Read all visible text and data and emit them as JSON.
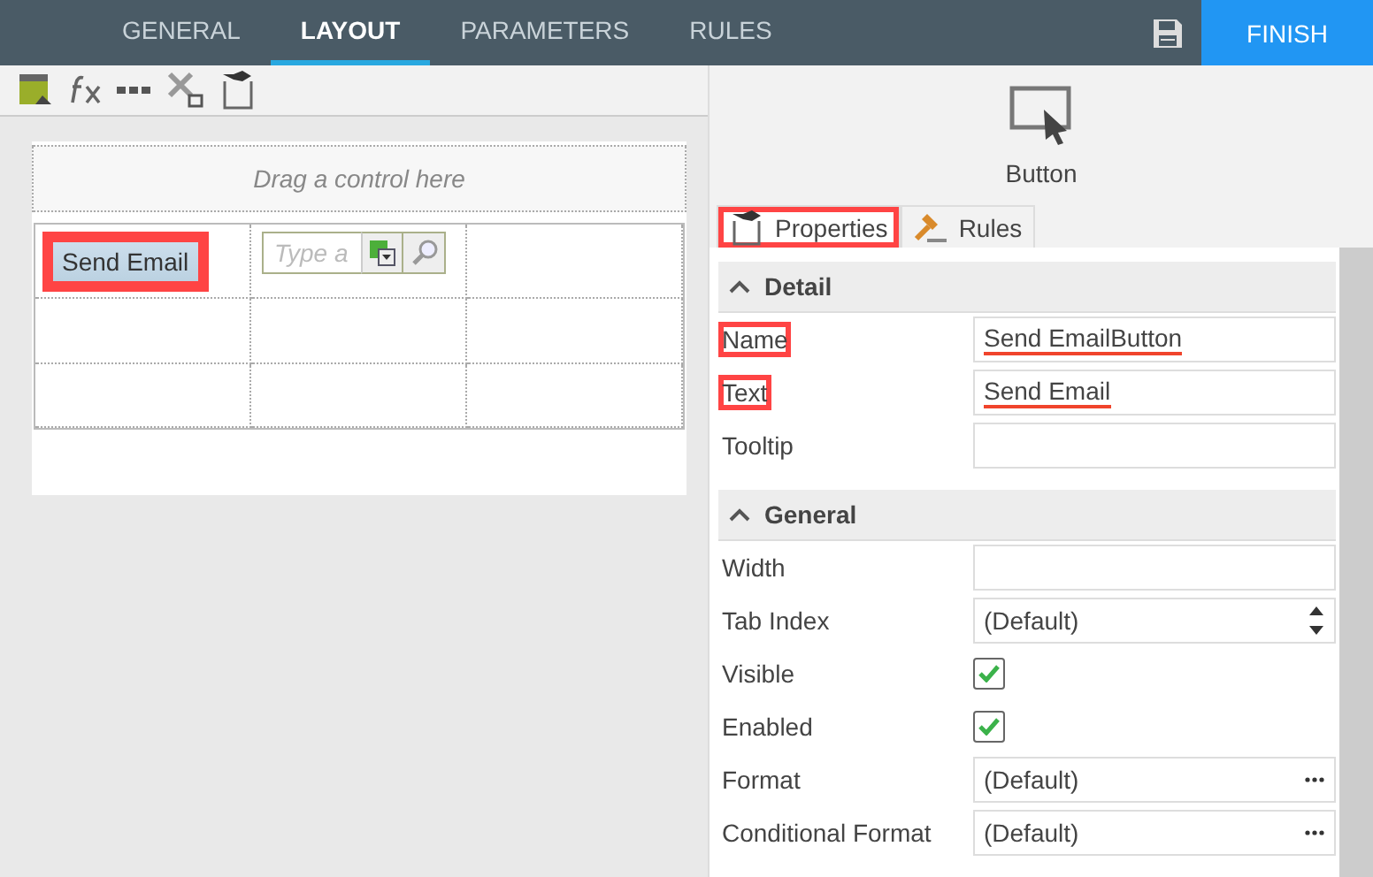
{
  "tabs": [
    {
      "label": "GENERAL",
      "selected": false
    },
    {
      "label": "LAYOUT",
      "selected": true
    },
    {
      "label": "PARAMETERS",
      "selected": false
    },
    {
      "label": "RULES",
      "selected": false
    }
  ],
  "finish_button": "FINISH",
  "canvas": {
    "drop_zone": "Drag a control here",
    "button": {
      "label": "Send Email",
      "highlighted": true
    },
    "picker": {
      "placeholder": "Type a"
    }
  },
  "control": {
    "type_label": "Button"
  },
  "panel_tabs": [
    {
      "label": "Properties",
      "selected": true,
      "highlighted": true
    },
    {
      "label": "Rules",
      "selected": false,
      "highlighted": false
    }
  ],
  "sections": [
    {
      "title": "Detail",
      "expanded": true,
      "rows": [
        {
          "label": "Name",
          "kind": "text",
          "value": "Send EmailButton",
          "highlighted": true,
          "underlined": true
        },
        {
          "label": "Text",
          "kind": "text",
          "value": "Send Email",
          "highlighted": true,
          "underlined": true
        },
        {
          "label": "Tooltip",
          "kind": "text",
          "highlighted": false
        }
      ]
    },
    {
      "title": "General",
      "expanded": true,
      "rows": [
        {
          "label": "Width",
          "kind": "text",
          "highlighted": false
        },
        {
          "label": "Tab Index",
          "kind": "spinner",
          "value": "(Default)",
          "highlighted": false
        },
        {
          "label": "Visible",
          "kind": "checkbox",
          "checked": true,
          "highlighted": false
        },
        {
          "label": "Enabled",
          "kind": "checkbox",
          "checked": true,
          "highlighted": false
        },
        {
          "label": "Format",
          "kind": "ellipsis",
          "value": "(Default)",
          "highlighted": false
        },
        {
          "label": "Conditional Format",
          "kind": "ellipsis",
          "value": "(Default)",
          "highlighted": false
        }
      ]
    }
  ]
}
